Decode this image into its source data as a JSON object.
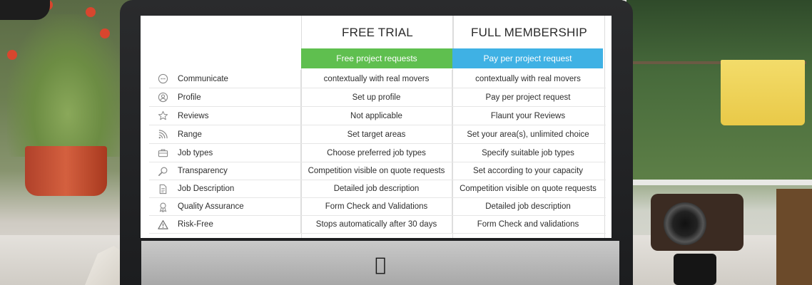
{
  "columns": {
    "free": {
      "title": "FREE TRIAL",
      "band": "Free project requests",
      "band_color": "#5fbf4f"
    },
    "full": {
      "title": "FULL MEMBERSHIP",
      "band": "Pay per project request",
      "band_color": "#3fb1e4"
    }
  },
  "rows": [
    {
      "icon": "chat-bubble-icon",
      "feature": "Communicate",
      "free": "contextually with real movers",
      "full": "contextually with real movers"
    },
    {
      "icon": "user-profile-icon",
      "feature": "Profile",
      "free": "Set up profile",
      "full": "Pay per project request"
    },
    {
      "icon": "star-icon",
      "feature": "Reviews",
      "free": "Not applicable",
      "full": "Flaunt your Reviews"
    },
    {
      "icon": "signal-range-icon",
      "feature": "Range",
      "free": "Set target areas",
      "full": "Set your area(s), unlimited choice"
    },
    {
      "icon": "briefcase-icon",
      "feature": "Job types",
      "free": "Choose preferred job types",
      "full": "Specify suitable job types"
    },
    {
      "icon": "magnifier-icon",
      "feature": "Transparency",
      "free": "Competition visible on quote requests",
      "full": "Set according to your capacity"
    },
    {
      "icon": "document-icon",
      "feature": "Job Description",
      "free": "Detailed job description",
      "full": "Competition visible on quote requests"
    },
    {
      "icon": "award-ribbon-icon",
      "feature": "Quality Assurance",
      "free": "Form Check and Validations",
      "full": "Detailed job description"
    },
    {
      "icon": "warning-triangle-icon",
      "feature": "Risk-Free",
      "free": "Stops automatically after 30 days",
      "full": "Form Check and validations"
    }
  ],
  "device": {
    "logo_icon": "apple-logo-icon"
  }
}
